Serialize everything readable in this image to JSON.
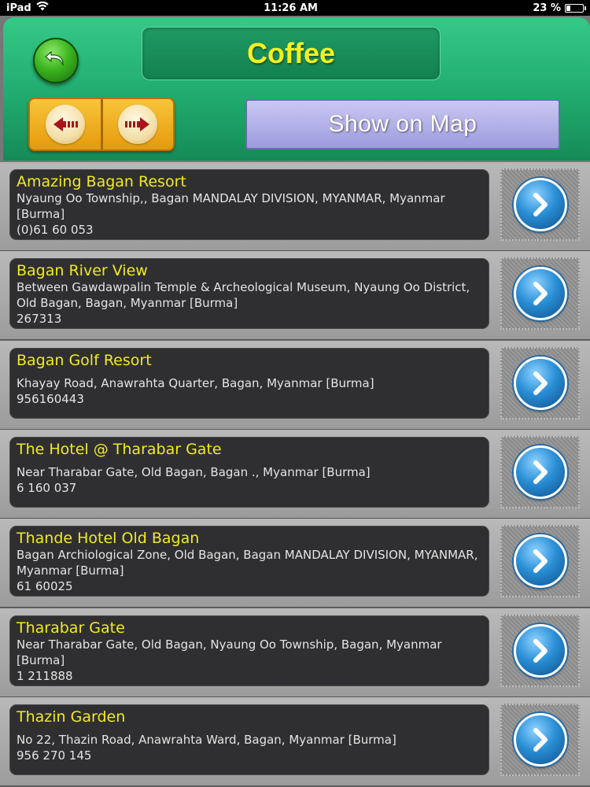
{
  "status": {
    "device": "iPad",
    "time": "11:26 AM",
    "battery": "23 %",
    "battery_level": 0.23
  },
  "header": {
    "title": "Coffee",
    "map_button_label": "Show on Map"
  },
  "icons": {
    "back": "back-arrow-icon",
    "prev": "left-arrow-icon",
    "next": "right-arrow-icon",
    "detail": "chevron-right-icon",
    "wifi": "wifi-icon",
    "battery": "battery-icon"
  },
  "colors": {
    "header_green": "#1fa86c",
    "title_yellow": "#f6f01d",
    "name_yellow": "#f1ea1f",
    "nav_orange": "#f0ae22",
    "map_button_purple": "#b3b1e8",
    "detail_blue": "#2a8fd6"
  },
  "places": [
    {
      "name": "Amazing Bagan Resort",
      "address": "Nyaung Oo Township,, Bagan MANDALAY DIVISION, MYANMAR, Myanmar [Burma]",
      "phone": "(0)61 60 053"
    },
    {
      "name": "Bagan River View",
      "address": "Between Gawdawpalin Temple & Archeological Museum, Nyaung Oo District, Old Bagan, Bagan, Myanmar [Burma]",
      "phone": "267313"
    },
    {
      "name": "Bagan Golf Resort",
      "address": "Khayay Road, Anawrahta Quarter, Bagan, Myanmar [Burma]",
      "phone": "956160443"
    },
    {
      "name": "The Hotel @ Tharabar Gate",
      "address": "Near Tharabar Gate, Old Bagan, Bagan ., Myanmar [Burma]",
      "phone": "6 160 037"
    },
    {
      "name": "Thande Hotel Old Bagan",
      "address": "Bagan Archiological Zone, Old Bagan, Bagan MANDALAY DIVISION, MYANMAR, Myanmar [Burma]",
      "phone": "61 60025"
    },
    {
      "name": "Tharabar Gate",
      "address": "Near Tharabar Gate, Old Bagan, Nyaung Oo Township, Bagan, Myanmar [Burma]",
      "phone": "1 211888"
    },
    {
      "name": "Thazin Garden",
      "address": "No 22, Thazin Road, Anawrahta Ward, Bagan, Myanmar [Burma]",
      "phone": "956 270 145"
    }
  ]
}
